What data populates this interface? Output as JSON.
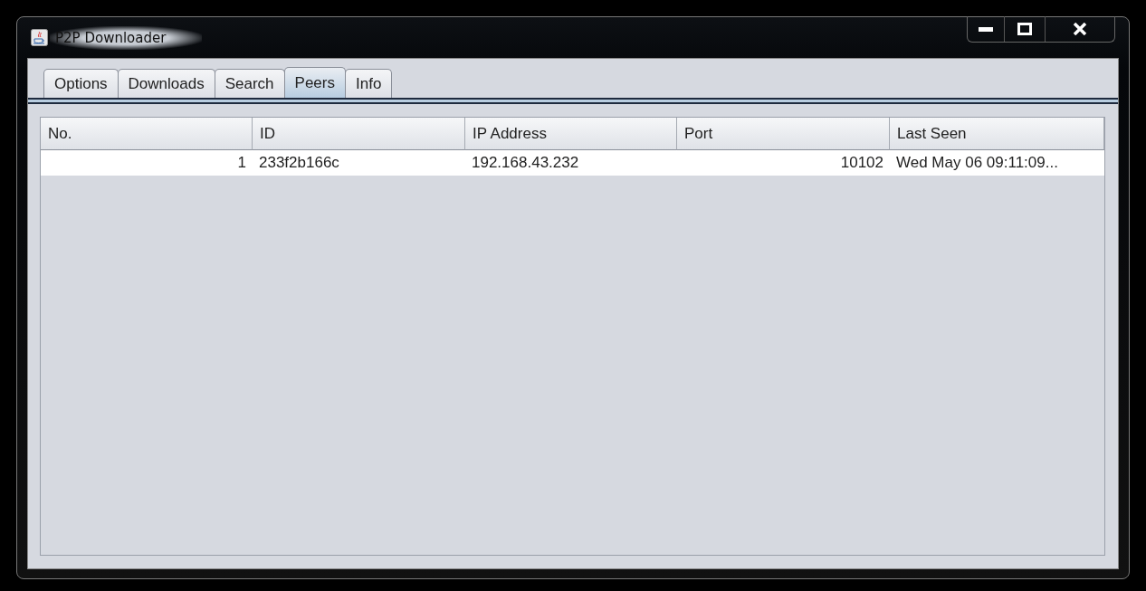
{
  "window": {
    "title": "P2P Downloader"
  },
  "tabs": [
    {
      "label": "Options",
      "selected": false
    },
    {
      "label": "Downloads",
      "selected": false
    },
    {
      "label": "Search",
      "selected": false
    },
    {
      "label": "Peers",
      "selected": true
    },
    {
      "label": "Info",
      "selected": false
    }
  ],
  "table": {
    "columns": [
      {
        "label": "No.",
        "kind": "number"
      },
      {
        "label": "ID",
        "kind": "text"
      },
      {
        "label": "IP Address",
        "kind": "text"
      },
      {
        "label": "Port",
        "kind": "number"
      },
      {
        "label": "Last Seen",
        "kind": "text"
      }
    ],
    "rows": [
      [
        "1",
        "233f2b166c",
        "192.168.43.232",
        "10102",
        "Wed May 06 09:11:09..."
      ]
    ]
  }
}
